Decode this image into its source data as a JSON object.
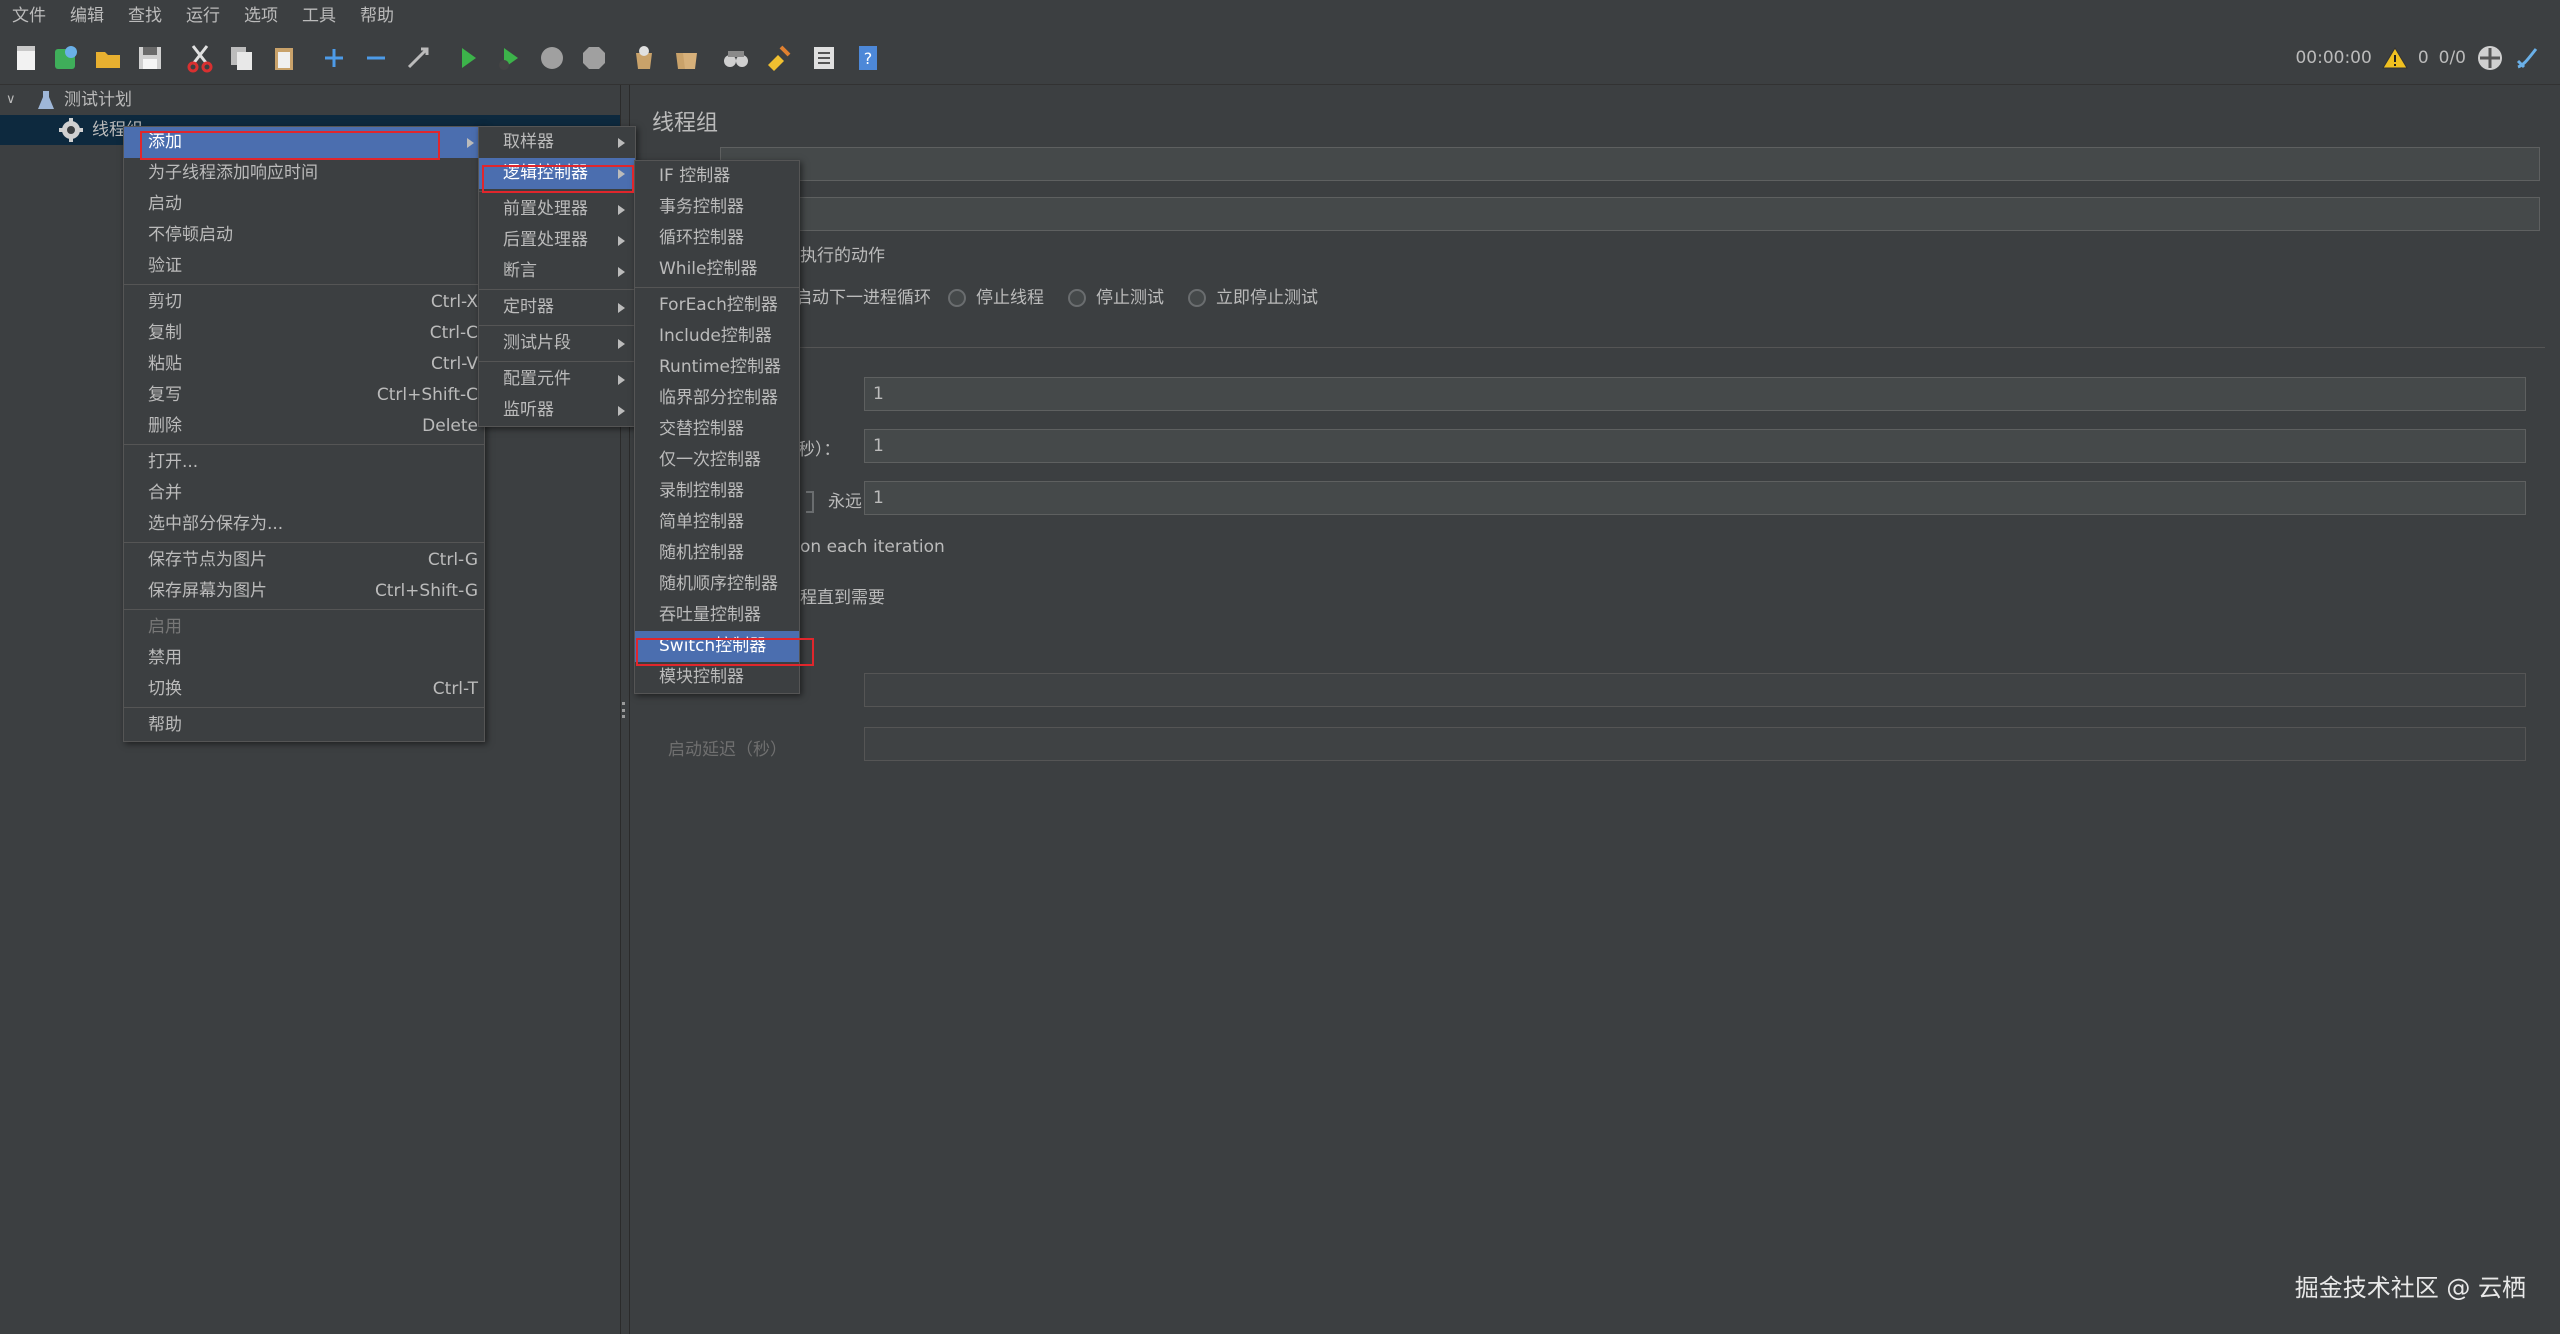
{
  "menubar": [
    "文件",
    "编辑",
    "查找",
    "运行",
    "选项",
    "工具",
    "帮助"
  ],
  "status": {
    "time": "00:00:00",
    "warnings": "0",
    "threads": "0/0"
  },
  "tree": {
    "root": "测试计划",
    "child": "线程组"
  },
  "panel": {
    "title": "线程组",
    "error_action_label": "执行的动作",
    "radio_next_loop": "启动下一进程循环",
    "radio_stop_thread": "停止线程",
    "radio_stop_test": "停止测试",
    "radio_stop_now": "立即停止测试",
    "threads_value": "1",
    "rampup_label": "秒）：",
    "rampup_value": "1",
    "loop_forever": "永远",
    "loop_value": "1",
    "same_user_label": "on each iteration",
    "delay_create_label": "程直到需要",
    "startup_delay_label": "启动延迟（秒）"
  },
  "context_menu": {
    "items": [
      {
        "label": "添加",
        "shortcut": "",
        "submenu": true,
        "selected": true
      },
      {
        "label": "为子线程添加响应时间",
        "shortcut": ""
      },
      {
        "label": "启动",
        "shortcut": ""
      },
      {
        "label": "不停顿启动",
        "shortcut": ""
      },
      {
        "label": "验证",
        "shortcut": "",
        "sep_after": true
      },
      {
        "label": "剪切",
        "shortcut": "Ctrl-X"
      },
      {
        "label": "复制",
        "shortcut": "Ctrl-C"
      },
      {
        "label": "粘贴",
        "shortcut": "Ctrl-V"
      },
      {
        "label": "复写",
        "shortcut": "Ctrl+Shift-C"
      },
      {
        "label": "删除",
        "shortcut": "Delete",
        "sep_after": true
      },
      {
        "label": "打开...",
        "shortcut": ""
      },
      {
        "label": "合并",
        "shortcut": ""
      },
      {
        "label": "选中部分保存为...",
        "shortcut": "",
        "sep_after": true
      },
      {
        "label": "保存节点为图片",
        "shortcut": "Ctrl-G"
      },
      {
        "label": "保存屏幕为图片",
        "shortcut": "Ctrl+Shift-G",
        "sep_after": true
      },
      {
        "label": "启用",
        "shortcut": "",
        "disabled": true
      },
      {
        "label": "禁用",
        "shortcut": ""
      },
      {
        "label": "切换",
        "shortcut": "Ctrl-T",
        "sep_after": true
      },
      {
        "label": "帮助",
        "shortcut": ""
      }
    ]
  },
  "add_submenu": {
    "items": [
      {
        "label": "取样器",
        "submenu": true
      },
      {
        "label": "逻辑控制器",
        "submenu": true,
        "selected": true,
        "sep_after": true
      },
      {
        "label": "前置处理器",
        "submenu": true
      },
      {
        "label": "后置处理器",
        "submenu": true
      },
      {
        "label": "断言",
        "submenu": true,
        "sep_after": true
      },
      {
        "label": "定时器",
        "submenu": true,
        "sep_after": true
      },
      {
        "label": "测试片段",
        "submenu": true,
        "sep_after": true
      },
      {
        "label": "配置元件",
        "submenu": true
      },
      {
        "label": "监听器",
        "submenu": true
      }
    ]
  },
  "logic_submenu": {
    "items": [
      {
        "label": "IF 控制器"
      },
      {
        "label": "事务控制器"
      },
      {
        "label": "循环控制器"
      },
      {
        "label": "While控制器",
        "sep_after": true
      },
      {
        "label": "ForEach控制器"
      },
      {
        "label": "Include控制器"
      },
      {
        "label": "Runtime控制器"
      },
      {
        "label": "临界部分控制器"
      },
      {
        "label": "交替控制器"
      },
      {
        "label": "仅一次控制器"
      },
      {
        "label": "录制控制器"
      },
      {
        "label": "简单控制器"
      },
      {
        "label": "随机控制器"
      },
      {
        "label": "随机顺序控制器"
      },
      {
        "label": "吞吐量控制器"
      },
      {
        "label": "Switch控制器",
        "selected": true
      },
      {
        "label": "模块控制器"
      }
    ]
  },
  "watermark": "掘金技术社区 @ 云栖",
  "colors": {
    "bg": "#3c3f41",
    "selection": "#4b6eaf",
    "highlight_box": "#e0262c"
  }
}
